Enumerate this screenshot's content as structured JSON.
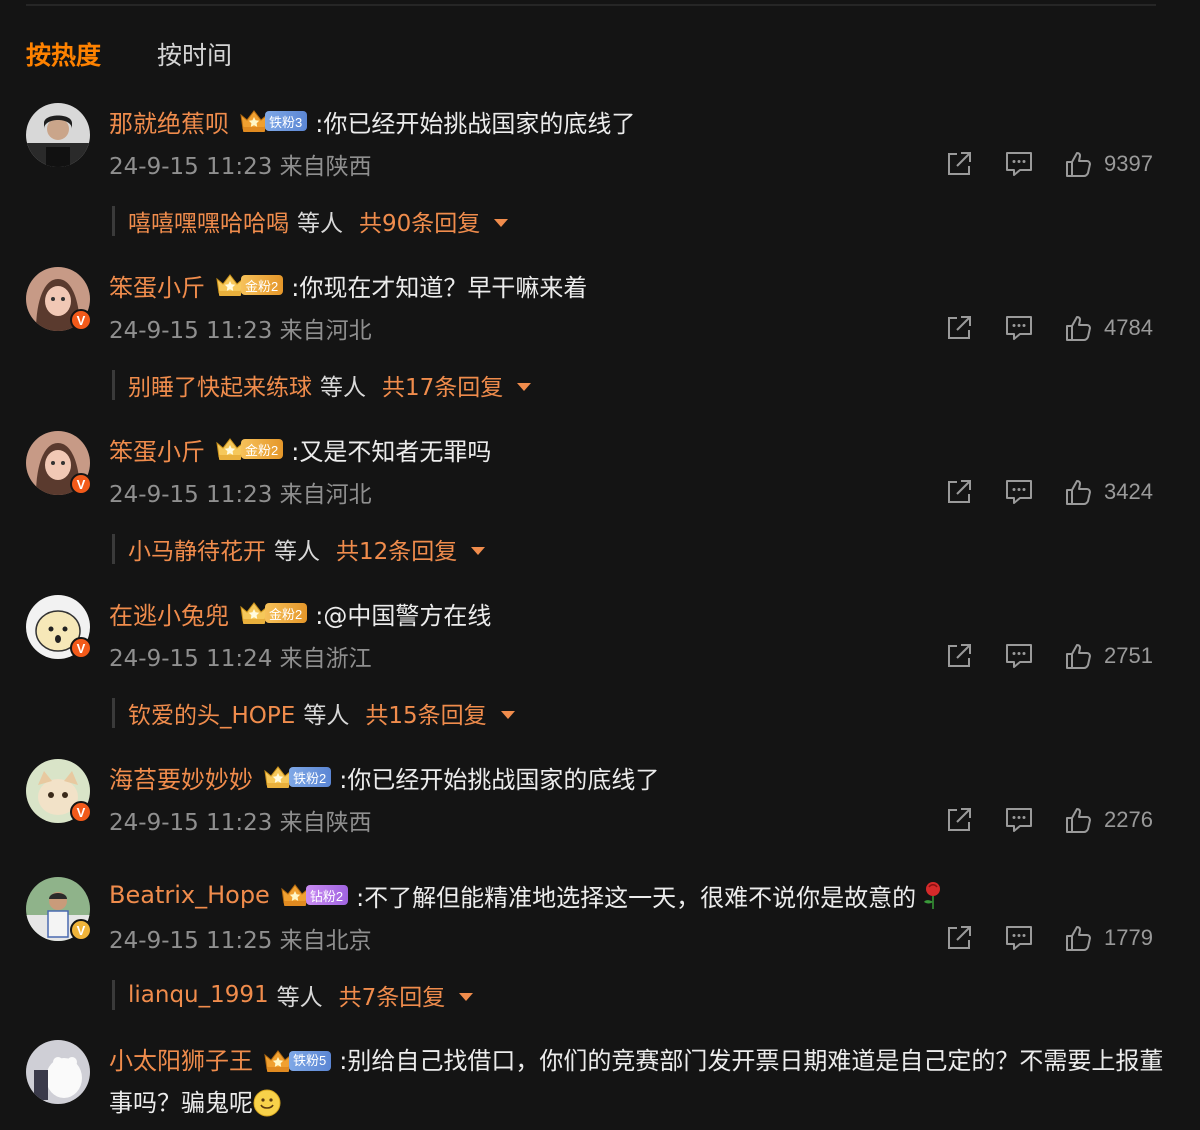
{
  "tabs": {
    "hot": "按热度",
    "time": "按时间"
  },
  "comments": [
    {
      "user": "那就绝蕉呗",
      "fan_label": "铁粉3",
      "fan_type": "iron",
      "text": ":你已经开始挑战国家的底线了",
      "meta": "24-9-15 11:23 来自陕西",
      "likes": "9397",
      "reply_users": "嘻嘻嘿嘿哈哈喝",
      "reply_etc": "等人",
      "reply_count": "共90条回复"
    },
    {
      "user": "笨蛋小斤",
      "fan_label": "金粉2",
      "fan_type": "gold",
      "text": ":你现在才知道？早干嘛来着",
      "meta": "24-9-15 11:23 来自河北",
      "likes": "4784",
      "reply_users": "别睡了快起来练球",
      "reply_etc": "等人",
      "reply_count": "共17条回复"
    },
    {
      "user": "笨蛋小斤",
      "fan_label": "金粉2",
      "fan_type": "gold",
      "text": ":又是不知者无罪吗",
      "meta": "24-9-15 11:23 来自河北",
      "likes": "3424",
      "reply_users": "小马静待花开",
      "reply_etc": "等人",
      "reply_count": "共12条回复"
    },
    {
      "user": "在逃小兔兜",
      "fan_label": "金粉2",
      "fan_type": "gold",
      "text": ":@中国警方在线",
      "meta": "24-9-15 11:24 来自浙江",
      "likes": "2751",
      "reply_users": "钦爱的头_HOPE",
      "reply_etc": "等人",
      "reply_count": "共15条回复"
    },
    {
      "user": "海苔要妙妙妙",
      "fan_label": "铁粉2",
      "fan_type": "iron",
      "text": ":你已经开始挑战国家的底线了",
      "meta": "24-9-15 11:23 来自陕西",
      "likes": "2276"
    },
    {
      "user": "Beatrix_Hope",
      "fan_label": "钻粉2",
      "fan_type": "diamond",
      "text": ":不了解但能精准地选择这一天，很难不说你是故意的",
      "meta": "24-9-15 11:25 来自北京",
      "likes": "1779",
      "reply_users": "lianqu_1991",
      "reply_etc": "等人",
      "reply_count": "共7条回复"
    },
    {
      "user": "小太阳狮子王",
      "fan_label": "铁粉5",
      "fan_type": "iron",
      "text": ":别给自己找借口，你们的竞赛部门发开票日期难道是自己定的？不需要上报董事吗？骗鬼呢"
    }
  ],
  "colors": {
    "accent": "#ff8200",
    "username": "#f08c4c",
    "background": "#141414"
  }
}
